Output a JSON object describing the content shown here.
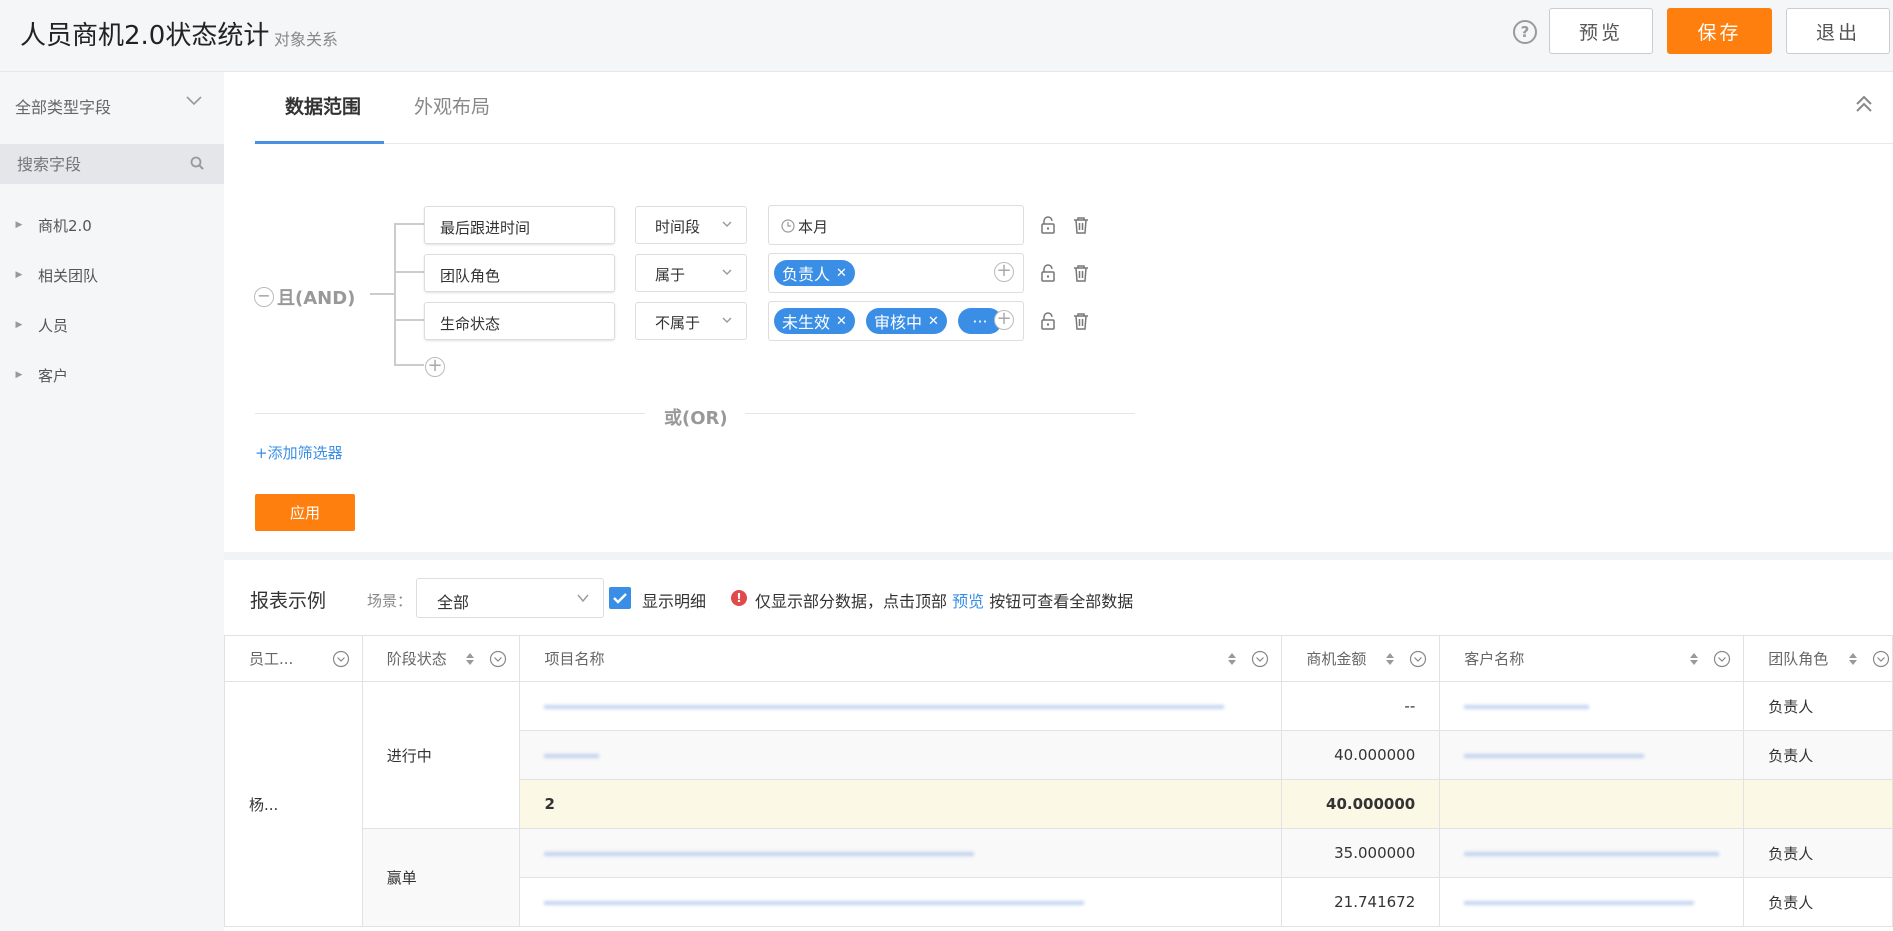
{
  "header": {
    "title": "人员商机2.0状态统计",
    "subtitle": "对象关系",
    "help": "?",
    "preview_btn": "预览",
    "save_btn": "保存",
    "exit_btn": "退出"
  },
  "sidebar": {
    "type_select": "全部类型字段",
    "search_placeholder": "搜索字段",
    "items": [
      {
        "label": "商机2.0"
      },
      {
        "label": "相关团队"
      },
      {
        "label": "人员"
      },
      {
        "label": "客户"
      }
    ]
  },
  "tabs": [
    {
      "label": "数据范围",
      "active": true
    },
    {
      "label": "外观布局",
      "active": false
    }
  ],
  "filter": {
    "minus": "−",
    "group_label": "且(AND)",
    "conditions": [
      {
        "field": "最后跟进时间",
        "operator": "时间段",
        "value": "本月"
      },
      {
        "field": "团队角色",
        "operator": "属于",
        "tags": [
          "负责人"
        ]
      },
      {
        "field": "生命状态",
        "operator": "不属于",
        "tags": [
          "未生效",
          "审核中",
          "···"
        ]
      }
    ],
    "or_label": "或(OR)",
    "add_filter": "+添加筛选器",
    "apply": "应用"
  },
  "report": {
    "title": "报表示例",
    "scene_label": "场景：",
    "scene_value": "全部",
    "show_detail": "显示明细",
    "warning_icon": "!",
    "warning_prefix": "仅显示部分数据，点击顶部",
    "warning_link": "预览",
    "warning_suffix": "按钮可查看全部数据",
    "columns": [
      "员工...",
      "阶段状态",
      "项目名称",
      "商机金额",
      "客户名称",
      "团队角色"
    ],
    "employee": "杨...",
    "stage_1": "进行中",
    "stage_2": "赢单",
    "rows": [
      {
        "amount": "--",
        "role": "负责人"
      },
      {
        "amount": "40.000000",
        "role": "负责人"
      },
      {
        "subtotal_count": "2",
        "subtotal_amount": "40.000000"
      },
      {
        "amount": "35.000000",
        "role": "负责人"
      },
      {
        "amount": "21.741672",
        "role": "负责人"
      }
    ]
  },
  "colors": {
    "accent": "#ff7f0e",
    "link": "#3a8ee6",
    "tag": "#3a8ee6"
  }
}
